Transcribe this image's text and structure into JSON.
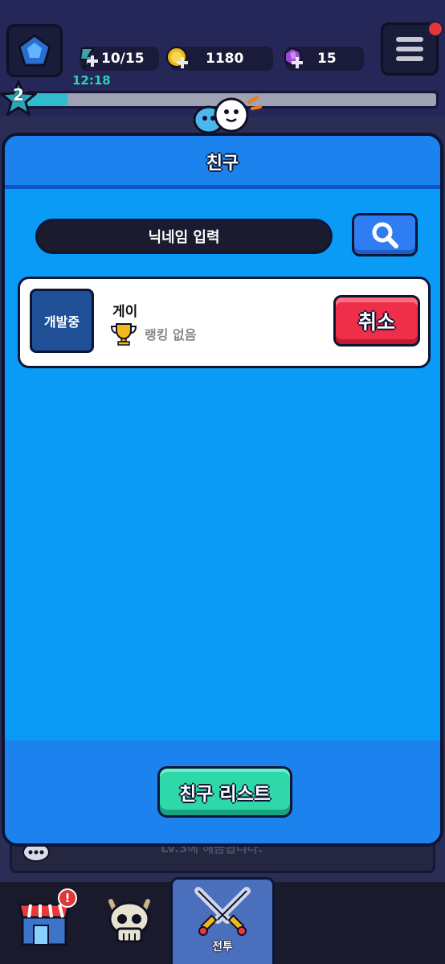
{
  "topbar": {
    "energy": "10/15",
    "coins": "1180",
    "gems": "15",
    "timer": "12:18",
    "level": "2",
    "xp_fraction": 0.1
  },
  "modal": {
    "title": "친구",
    "search_placeholder": "닉네임 입력",
    "friends": [
      {
        "avatar_label": "개발중",
        "name": "게이",
        "rank": "랭킹 없음",
        "action_label": "취소"
      }
    ],
    "friend_list_label": "친구 리스트"
  },
  "background": {
    "partial_text": "LV.3에 해금됩니다."
  },
  "bottom_nav": {
    "items": [
      {
        "icon": "shop-icon",
        "badge": "!"
      },
      {
        "icon": "skull-icon"
      },
      {
        "icon": "swords-icon",
        "label": "전투"
      }
    ]
  },
  "colors": {
    "modal_bg": "#0a9bf6",
    "header_bg": "#1b82ee",
    "cancel": "#ef2f4a",
    "friend_list": "#2fd8a8",
    "topbar": "#242757"
  }
}
